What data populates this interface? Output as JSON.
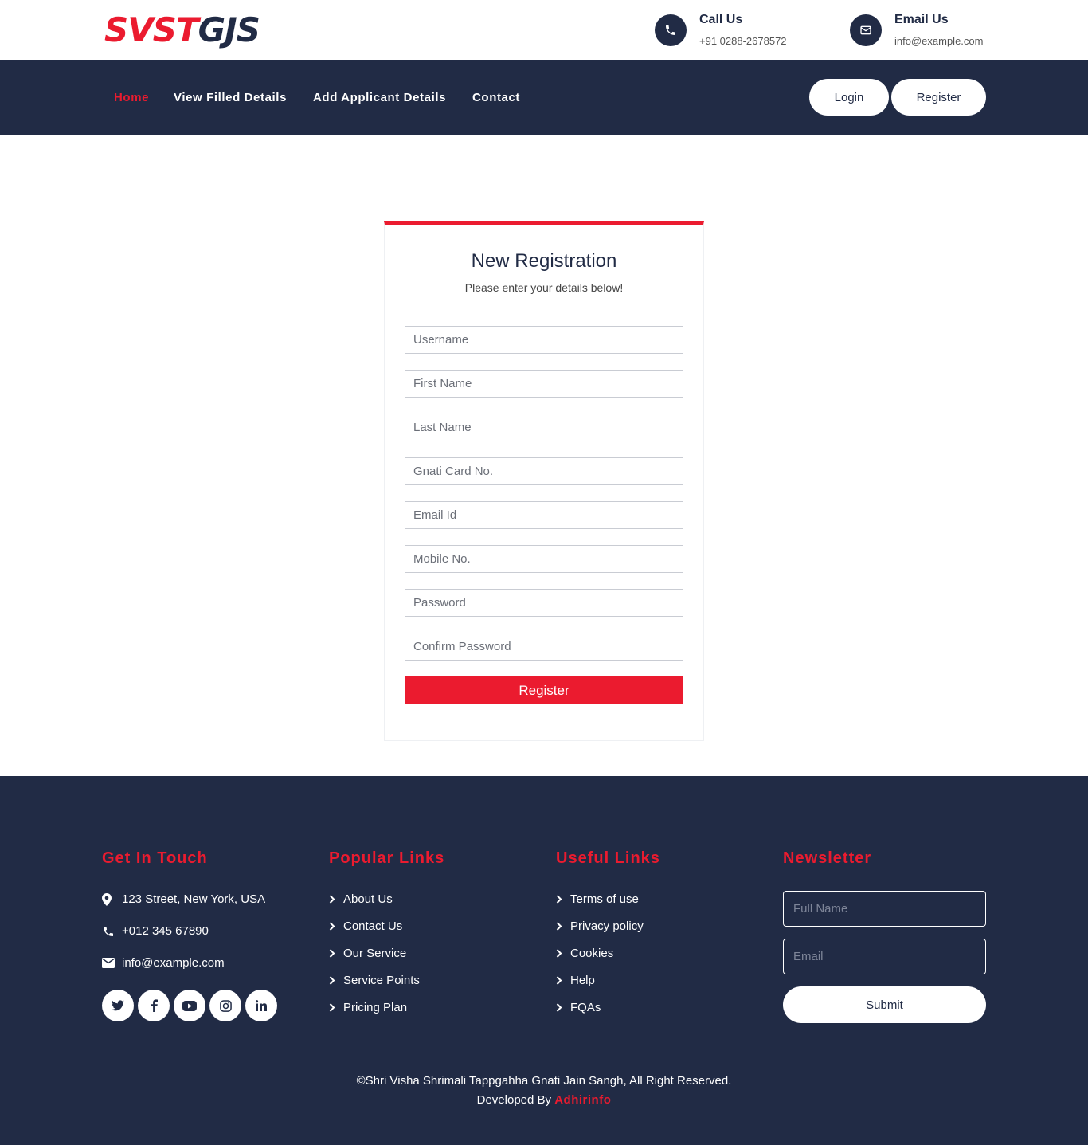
{
  "header": {
    "logo_part1": "SVST",
    "logo_part2": "GJS",
    "call": {
      "title": "Call Us",
      "value": "+91 0288-2678572",
      "icon": "phone-icon"
    },
    "email": {
      "title": "Email Us",
      "value": "info@example.com",
      "icon": "envelope-icon"
    }
  },
  "nav": {
    "links": [
      "Home",
      "View Filled Details",
      "Add Applicant Details",
      "Contact"
    ],
    "active": "Home",
    "login_label": "Login",
    "register_label": "Register"
  },
  "form": {
    "title": "New Registration",
    "subtitle": "Please enter your details below!",
    "fields": [
      {
        "placeholder": "Username",
        "value": ""
      },
      {
        "placeholder": "First Name",
        "value": ""
      },
      {
        "placeholder": "Last Name",
        "value": ""
      },
      {
        "placeholder": "Gnati Card No.",
        "value": ""
      },
      {
        "placeholder": "Email Id",
        "value": ""
      },
      {
        "placeholder": "Mobile No.",
        "value": ""
      },
      {
        "placeholder": "Password",
        "value": ""
      },
      {
        "placeholder": "Confirm Password",
        "value": ""
      }
    ],
    "submit_label": "Register"
  },
  "footer": {
    "get_in_touch": {
      "heading": "Get In Touch",
      "address": "123 Street, New York, USA",
      "phone": "+012 345 67890",
      "email": "info@example.com",
      "socials": [
        "twitter-icon",
        "facebook-icon",
        "youtube-icon",
        "instagram-icon",
        "linkedin-icon"
      ]
    },
    "popular_links": {
      "heading": "Popular Links",
      "items": [
        "About Us",
        "Contact Us",
        "Our Service",
        "Service Points",
        "Pricing Plan"
      ]
    },
    "useful_links": {
      "heading": "Useful Links",
      "items": [
        "Terms of use",
        "Privacy policy",
        "Cookies",
        "Help",
        "FQAs"
      ]
    },
    "newsletter": {
      "heading": "Newsletter",
      "name_placeholder": "Full Name",
      "email_placeholder": "Email",
      "submit_label": "Submit"
    },
    "copyright": "©Shri Visha Shrimali Tappgahha Gnati Jain Sangh, All Right Reserved.",
    "developed_by": "Developed By",
    "developer": "Adhirinfo"
  },
  "colors": {
    "navy": "#212b45",
    "accent": "#eb1b2f",
    "white": "#ffffff"
  }
}
